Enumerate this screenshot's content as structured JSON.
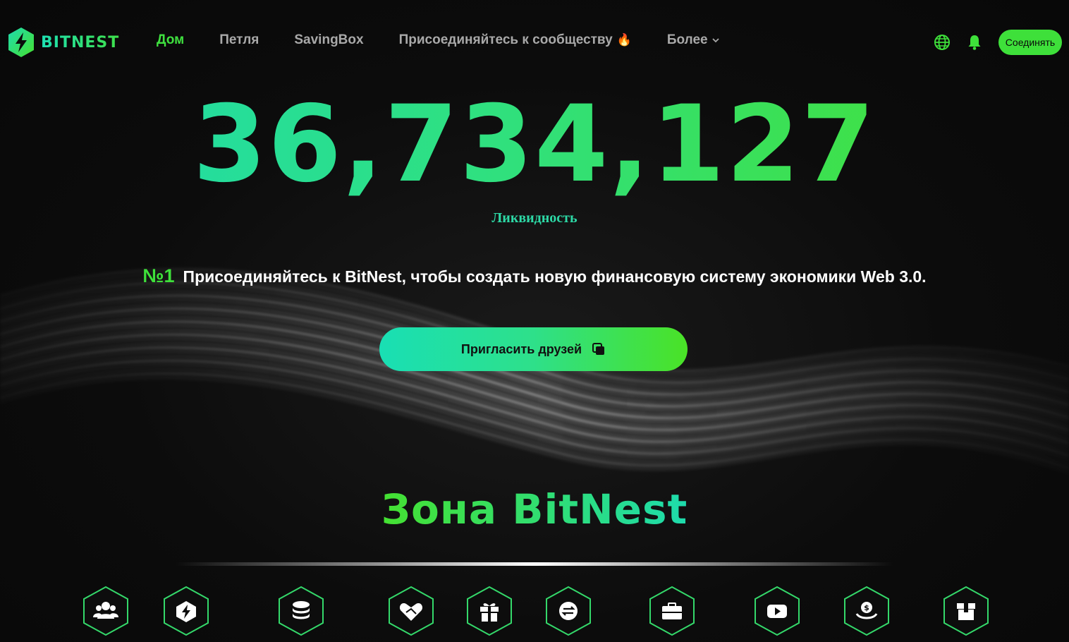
{
  "brand": {
    "name": "BITNEST",
    "accent_green": "#3ee03a",
    "accent_teal": "#1ddbb0"
  },
  "nav": {
    "home": "Дом",
    "loop": "Петля",
    "savingbox": "SavingBox",
    "community": "Присоединяйтесь к сообществу",
    "community_emoji": "🔥",
    "more": "Более"
  },
  "header": {
    "connect_label": "Соединять",
    "language_icon": "globe-icon",
    "notify_icon": "bell-icon"
  },
  "hero": {
    "liquidity_value": "36,734,127",
    "liquidity_label": "Ликвидность",
    "rank": "№1",
    "tagline": "Присоединяйтесь к BitNest, чтобы создать новую финансовую систему экономики Web 3.0.",
    "invite_label": "Пригласить друзей"
  },
  "zone": {
    "title": "Зона BitNest",
    "icons": [
      "users-icon",
      "bolt-icon",
      "coins-stack-icon",
      "handshake-heart-icon",
      "gift-icon",
      "exchange-icon",
      "briefcase-icon",
      "video-play-icon",
      "dollar-hand-icon",
      "box-icon"
    ]
  }
}
